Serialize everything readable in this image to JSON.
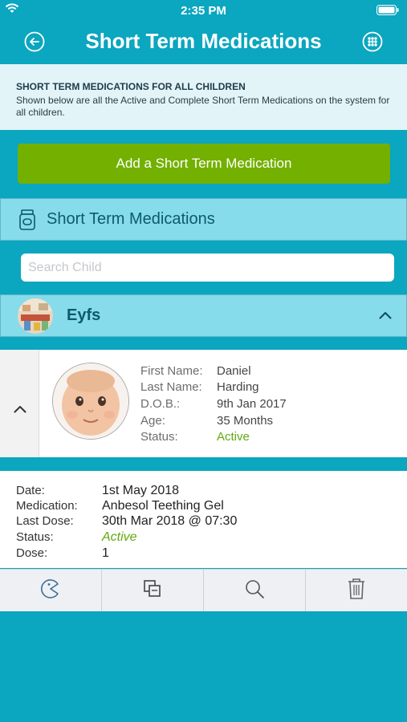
{
  "status_bar": {
    "time": "2:35 PM"
  },
  "header": {
    "title": "Short Term Medications"
  },
  "info": {
    "heading": "SHORT TERM MEDICATIONS FOR ALL CHILDREN",
    "description": "Shown below are all the Active and Complete Short Term Medications on the system for all children."
  },
  "add_button": {
    "label": "Add a Short Term Medication"
  },
  "section": {
    "label": "Short Term Medications"
  },
  "search": {
    "placeholder": "Search Child",
    "value": ""
  },
  "group": {
    "name": "Eyfs"
  },
  "child": {
    "labels": {
      "first_name": "First Name:",
      "last_name": "Last Name:",
      "dob": "D.O.B.:",
      "age": "Age:",
      "status": "Status:"
    },
    "values": {
      "first_name": "Daniel",
      "last_name": "Harding",
      "dob": "9th Jan 2017",
      "age": "35 Months",
      "status": "Active"
    }
  },
  "record": {
    "labels": {
      "date": "Date:",
      "medication": "Medication:",
      "last_dose": "Last Dose:",
      "status": "Status:",
      "dose": "Dose:"
    },
    "values": {
      "date": "1st May 2018",
      "medication": "Anbesol Teething Gel",
      "last_dose": "30th Mar 2018 @ 07:30",
      "status": "Active",
      "dose": "1"
    }
  },
  "toolbar": {
    "icons": [
      "pacman-icon",
      "copy-icon",
      "search-icon",
      "trash-icon"
    ]
  },
  "colors": {
    "background": "#0ba6bf",
    "accent_green": "#73b000",
    "active_text": "#63a80f",
    "section_bg": "#86dcea"
  }
}
